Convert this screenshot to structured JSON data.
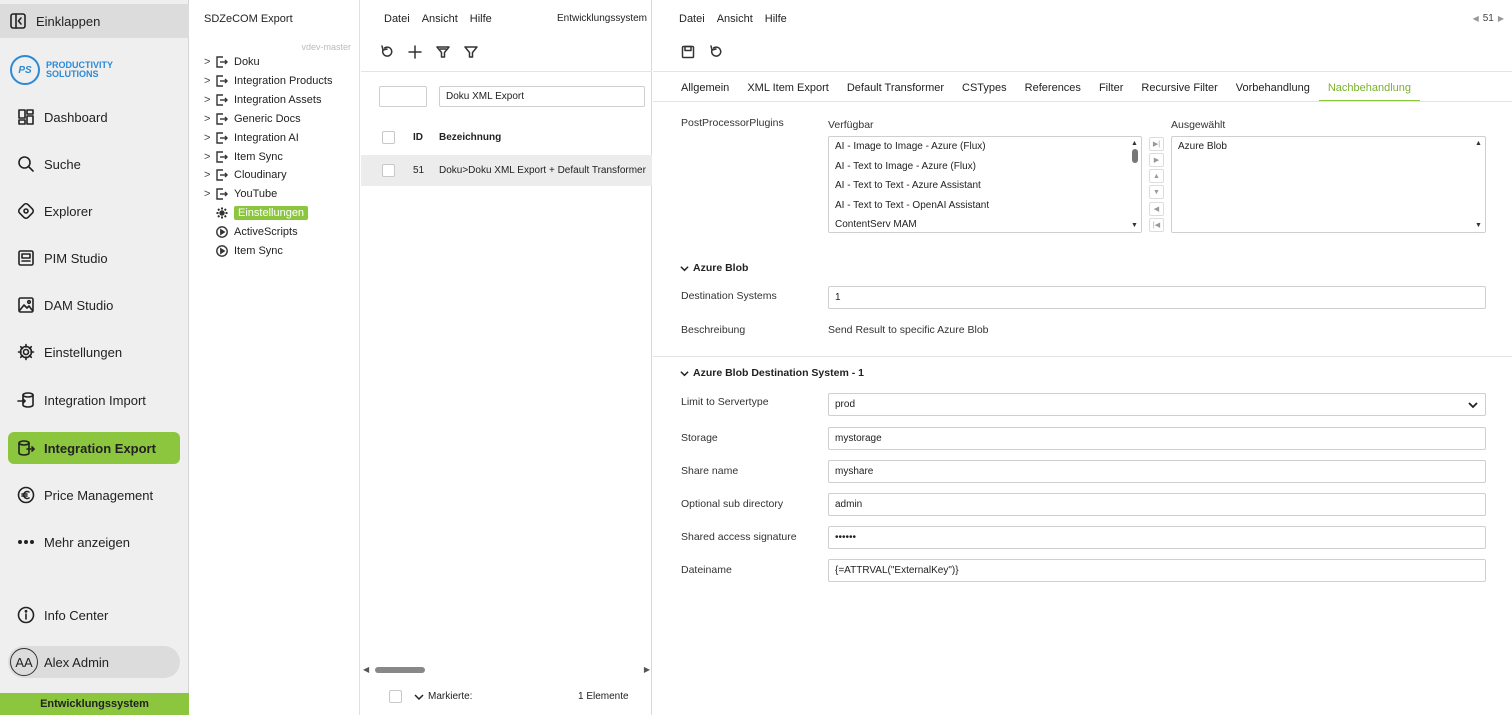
{
  "nav": {
    "collapse": "Einklappen",
    "logo_mark": "PS",
    "logo_line1": "PRODUCTIVITY",
    "logo_line2": "SOLUTIONS",
    "items": [
      {
        "label": "Dashboard",
        "icon": "dashboard-icon"
      },
      {
        "label": "Suche",
        "icon": "search-icon"
      },
      {
        "label": "Explorer",
        "icon": "explorer-icon"
      },
      {
        "label": "PIM Studio",
        "icon": "pim-studio-icon"
      },
      {
        "label": "DAM Studio",
        "icon": "image-icon"
      },
      {
        "label": "Einstellungen",
        "icon": "gear-icon"
      },
      {
        "label": "Integration Import",
        "icon": "import-icon"
      },
      {
        "label": "Integration Export",
        "icon": "export-icon"
      },
      {
        "label": "Price Management",
        "icon": "euro-icon"
      },
      {
        "label": "Mehr anzeigen",
        "icon": "more-icon"
      }
    ],
    "info_center": "Info Center",
    "user_initials": "AA",
    "user_name": "Alex Admin",
    "environment": "Entwicklungssystem",
    "accent": "#8cc63f"
  },
  "tree": {
    "title": "SDZeCOM Export",
    "branch": "vdev-master",
    "items": [
      {
        "label": "Doku"
      },
      {
        "label": "Integration Products"
      },
      {
        "label": "Integration Assets"
      },
      {
        "label": "Generic Docs"
      },
      {
        "label": "Integration AI"
      },
      {
        "label": "Item Sync"
      },
      {
        "label": "Cloudinary"
      },
      {
        "label": "YouTube"
      },
      {
        "label": "Einstellungen"
      },
      {
        "label": "ActiveScripts"
      },
      {
        "label": "Item Sync"
      }
    ]
  },
  "list": {
    "menu": [
      "Datei",
      "Ansicht",
      "Hilfe"
    ],
    "env": "Entwicklungssystem",
    "search_value": "Doku XML Export",
    "col_id": "ID",
    "col_name": "Bezeichnung",
    "rows": [
      {
        "id": "51",
        "name": "Doku>Doku XML Export + Default Transformer"
      }
    ],
    "footer_marked": "Markierte:",
    "footer_count": "1 Elemente"
  },
  "detail": {
    "menu": [
      "Datei",
      "Ansicht",
      "Hilfe"
    ],
    "page": "51",
    "tabs": [
      "Allgemein",
      "XML Item Export",
      "Default Transformer",
      "CSTypes",
      "References",
      "Filter",
      "Recursive Filter",
      "Vorbehandlung",
      "Nachbehandlung"
    ],
    "active_tab": "Nachbehandlung",
    "plugins_label": "PostProcessorPlugins",
    "available_label": "Verfügbar",
    "selected_label": "Ausgewählt",
    "available": [
      "AI - Image to Image - Azure (Flux)",
      "AI - Text to Image - Azure (Flux)",
      "AI - Text to Text - Azure Assistant",
      "AI - Text to Text - OpenAI Assistant",
      "ContentServ MAM"
    ],
    "selected": [
      "Azure Blob"
    ],
    "section1": "Azure Blob",
    "dest_label": "Destination Systems",
    "dest_value": "1",
    "desc_label": "Beschreibung",
    "desc_value": "Send Result to specific Azure Blob",
    "section2": "Azure Blob Destination System - 1",
    "fields": [
      {
        "label": "Limit to Servertype",
        "value": "prod"
      },
      {
        "label": "Storage",
        "value": "mystorage"
      },
      {
        "label": "Share name",
        "value": "myshare"
      },
      {
        "label": "Optional sub directory",
        "value": "admin"
      },
      {
        "label": "Shared access signature",
        "value": "••••••"
      },
      {
        "label": "Dateiname",
        "value": "{=ATTRVAL(\"ExternalKey\")}"
      }
    ]
  }
}
